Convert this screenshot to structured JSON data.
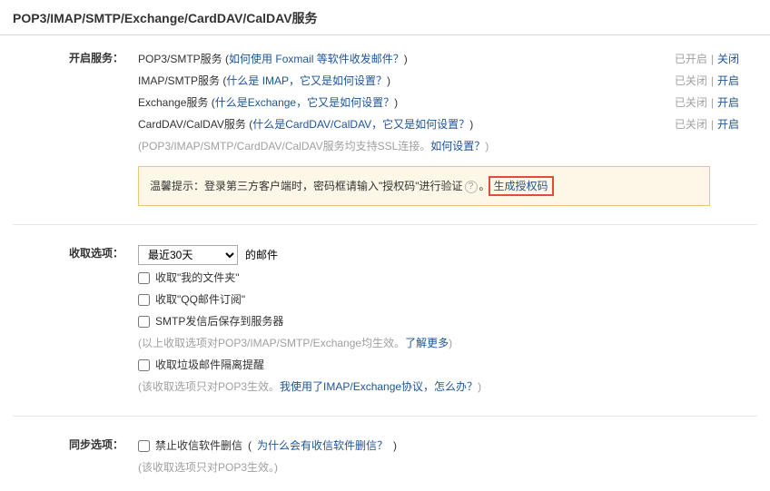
{
  "title": "POP3/IMAP/SMTP/Exchange/CardDAV/CalDAV服务",
  "labels": {
    "enable_service": "开启服务：",
    "receive_options": "收取选项：",
    "sync_options": "同步选项："
  },
  "services": [
    {
      "name": "POP3/SMTP服务",
      "help_prefix": "(",
      "help_text": "如何使用 Foxmail 等软件收发邮件？",
      "help_suffix": ")",
      "status": "已开启",
      "action": "关闭"
    },
    {
      "name": "IMAP/SMTP服务",
      "help_prefix": "(",
      "help_text": "什么是 IMAP，它又是如何设置？",
      "help_suffix": ")",
      "status": "已关闭",
      "action": "开启"
    },
    {
      "name": "Exchange服务",
      "help_prefix": "(",
      "help_text": "什么是Exchange，它又是如何设置？",
      "help_suffix": ")",
      "status": "已关闭",
      "action": "开启"
    },
    {
      "name": "CardDAV/CalDAV服务",
      "help_prefix": "(",
      "help_text": "什么是CardDAV/CalDAV，它又是如何设置？",
      "help_suffix": ")",
      "status": "已关闭",
      "action": "开启"
    }
  ],
  "ssl_note": {
    "prefix": "(POP3/IMAP/SMTP/CardDAV/CalDAV服务均支持SSL连接。",
    "link": "如何设置？",
    "suffix": ")"
  },
  "tip": {
    "prefix": "温馨提示：登录第三方客户端时，密码框请输入\"授权码\"进行验证",
    "help_icon": "?",
    "period": "。",
    "generate_link": "生成授权码"
  },
  "receive": {
    "select_value": "最近30天",
    "select_suffix": "的邮件",
    "checkboxes": [
      {
        "label": "收取\"我的文件夹\""
      },
      {
        "label": "收取\"QQ邮件订阅\""
      },
      {
        "label": "SMTP发信后保存到服务器"
      }
    ],
    "note1_prefix": "(以上收取选项对POP3/IMAP/SMTP/Exchange均生效。",
    "note1_link": "了解更多",
    "note1_suffix": ")",
    "checkbox4": {
      "label": "收取垃圾邮件隔离提醒"
    },
    "note2_prefix": "(该收取选项只对POP3生效。",
    "note2_link": "我使用了IMAP/Exchange协议，怎么办？",
    "note2_suffix": ")"
  },
  "sync": {
    "checkbox": {
      "label": "禁止收信软件删信"
    },
    "help_prefix": "(",
    "help_link": "为什么会有收信软件删信？",
    "help_suffix": ")",
    "note": "(该收取选项只对POP3生效。)"
  },
  "sep": "|"
}
